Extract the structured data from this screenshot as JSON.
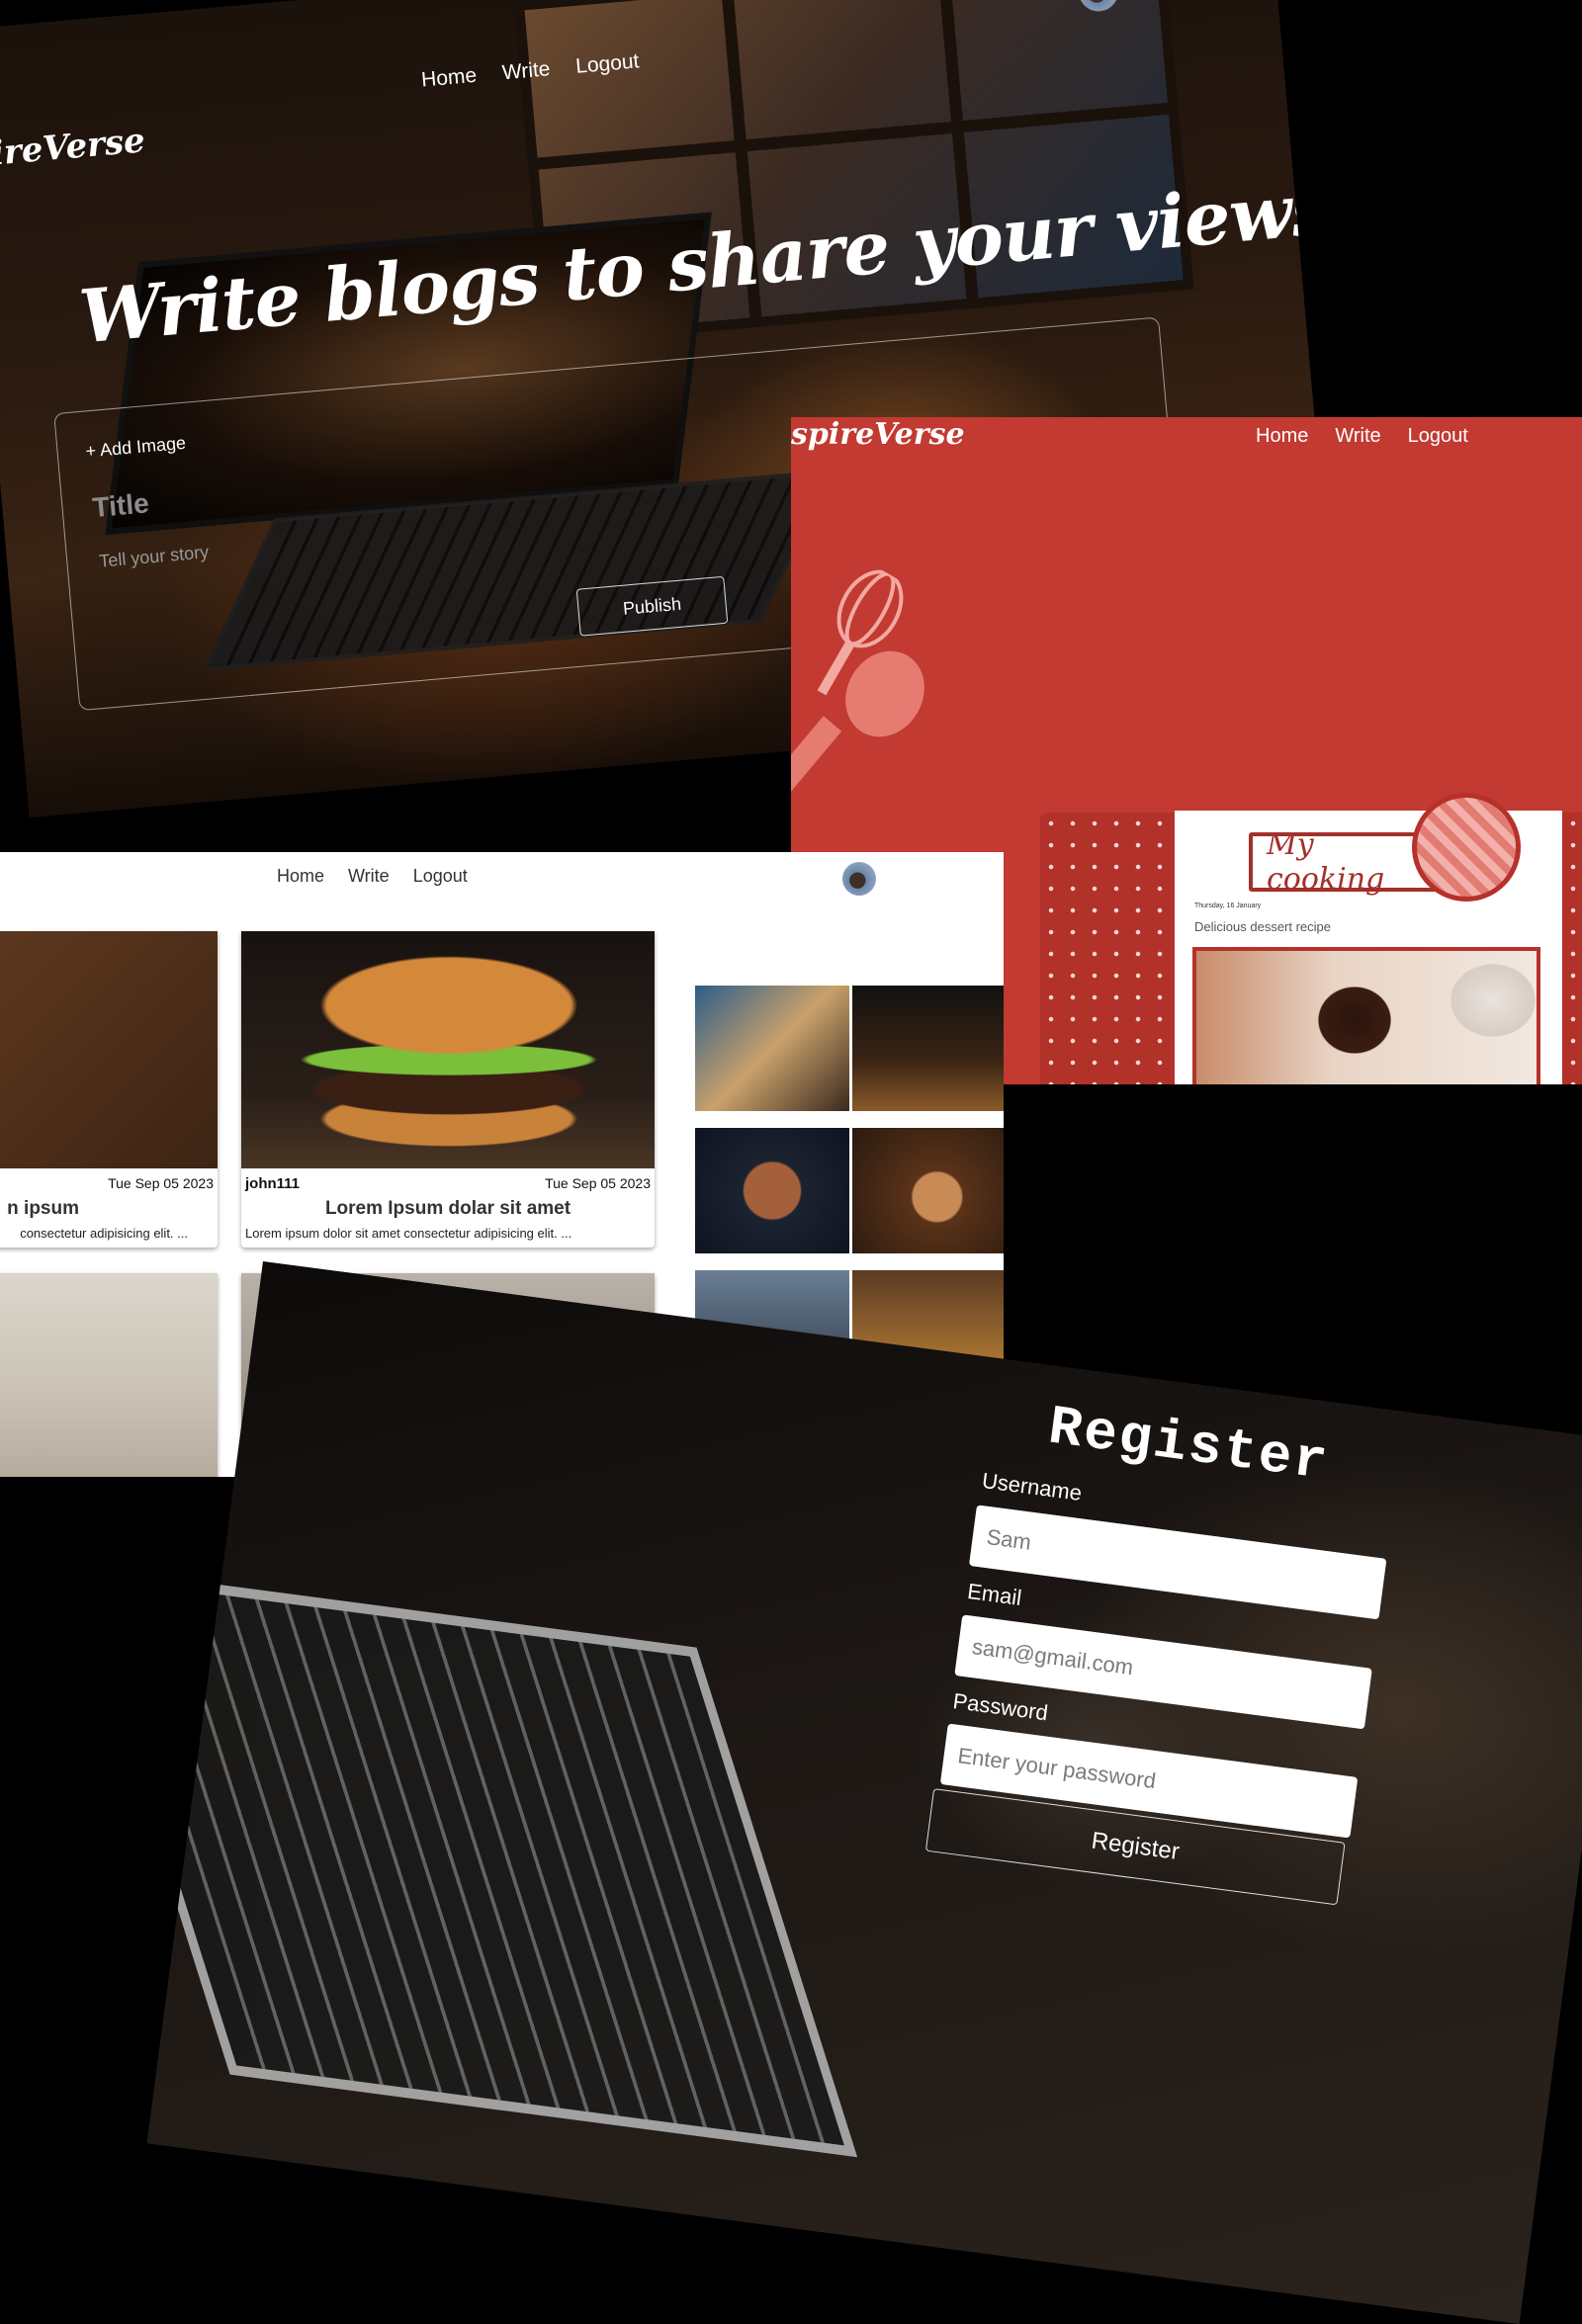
{
  "write_page": {
    "brand": "ireVerse",
    "nav": [
      "Home",
      "Write",
      "Logout"
    ],
    "hero": "Write blogs to share your views",
    "add_image": "Add Image",
    "title_placeholder": "Title",
    "story_placeholder": "Tell your story",
    "publish": "Publish"
  },
  "cooking_page": {
    "brand": "spireVerse",
    "nav": [
      "Home",
      "Write",
      "Logout"
    ],
    "banner": "My cooking",
    "date": "Thursday, 16 January",
    "description": "Delicious dessert recipe"
  },
  "blog_grid": {
    "nav": [
      "Home",
      "Write",
      "Logout"
    ],
    "cards": [
      {
        "author": "",
        "date": "Tue Sep 05 2023",
        "title": "n ipsum",
        "excerpt": "consectetur adipisicing elit. ..."
      },
      {
        "author": "john111",
        "date": "Tue Sep 05 2023",
        "title": "Lorem Ipsum dolar sit amet",
        "excerpt": "Lorem ipsum dolor sit amet consectetur adipisicing elit. ..."
      }
    ]
  },
  "register_page": {
    "title": "Register",
    "username_label": "Username",
    "username_placeholder": "Sam",
    "email_label": "Email",
    "email_placeholder": "sam@gmail.com",
    "password_label": "Password",
    "password_placeholder": "Enter your password",
    "submit": "Register"
  },
  "colors": {
    "cooking_red": "#c23a31",
    "dark_bg": "#1b120c"
  }
}
